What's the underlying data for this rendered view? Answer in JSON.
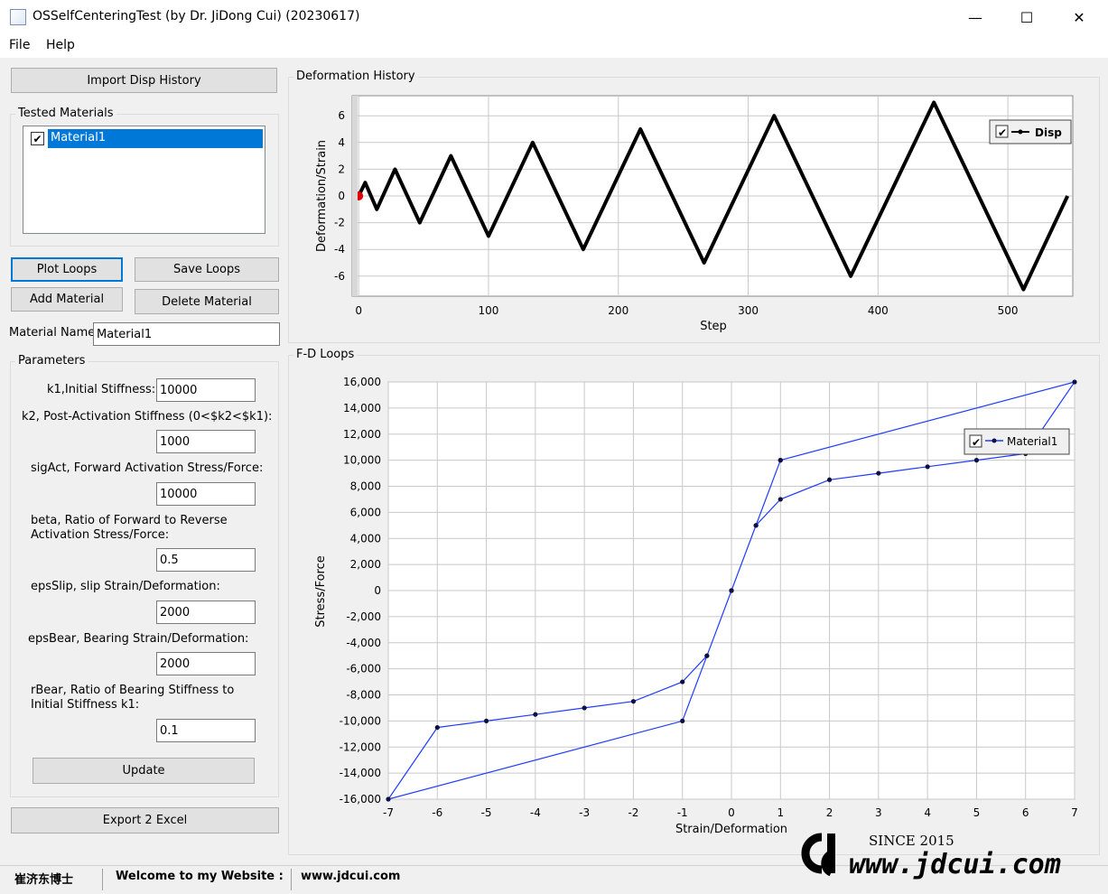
{
  "window": {
    "title": "OSSelfCenteringTest (by Dr. JiDong Cui) (20230617)",
    "minimize": "—",
    "maximize": "☐",
    "close": "✕"
  },
  "menu": {
    "file": "File",
    "help": "Help"
  },
  "left": {
    "import_button": "Import Disp History",
    "tested_materials_label": "Tested Materials",
    "materials": [
      {
        "name": "Material1",
        "checked": true
      }
    ],
    "plot_loops": "Plot Loops",
    "save_loops": "Save Loops",
    "add_material": "Add Material",
    "delete_material": "Delete Material",
    "material_name_label": "Material Name",
    "material_name_value": "Material1",
    "parameters_label": "Parameters",
    "params": {
      "k1_label": "k1,Initial Stiffness:",
      "k1_value": "10000",
      "k2_label": "k2, Post-Activation Stiffness (0<$k2<$k1):",
      "k2_value": "1000",
      "sigact_label": "sigAct, Forward Activation Stress/Force:",
      "sigact_value": "10000",
      "beta_label_1": "beta, Ratio of Forward to Reverse",
      "beta_label_2": "Activation Stress/Force:",
      "beta_value": "0.5",
      "epsslip_label": "epsSlip, slip Strain/Deformation:",
      "epsslip_value": "2000",
      "epsbear_label": "epsBear, Bearing Strain/Deformation:",
      "epsbear_value": "2000",
      "rbear_label_1": "rBear, Ratio of Bearing Stiffness to",
      "rbear_label_2": "Initial Stiffness k1:",
      "rbear_value": "0.1"
    },
    "update_button": "Update",
    "export_button": "Export 2 Excel"
  },
  "deformation_history": {
    "panel_label": "Deformation History",
    "chart_data": {
      "type": "line",
      "xlabel": "Step",
      "ylabel": "Deformation/Strain",
      "xlim": [
        -5,
        550
      ],
      "ylim": [
        -7.5,
        7.5
      ],
      "xticks": [
        0,
        100,
        200,
        300,
        400,
        500
      ],
      "yticks": [
        -6,
        -4,
        -2,
        0,
        2,
        4,
        6
      ],
      "grid": true,
      "legend_position": "top-right",
      "series": [
        {
          "name": "Disp",
          "color": "#000000",
          "x": [
            0,
            5,
            14,
            28,
            47,
            71,
            100,
            134,
            173,
            217,
            266,
            320,
            379,
            443,
            512,
            546
          ],
          "y": [
            0,
            1,
            -1,
            2,
            -2,
            3,
            -3,
            4,
            -4,
            5,
            -5,
            6,
            -6,
            7,
            -7,
            0
          ]
        }
      ],
      "marker": {
        "x": 0,
        "y": 0,
        "color": "#e00000"
      }
    }
  },
  "fd_loops": {
    "panel_label": "F-D Loops",
    "chart_data": {
      "type": "line",
      "xlabel": "Strain/Deformation",
      "ylabel": "Stress/Force",
      "xlim": [
        -7,
        7
      ],
      "ylim": [
        -16000,
        16000
      ],
      "xticks": [
        -7,
        -6,
        -5,
        -4,
        -3,
        -2,
        -1,
        0,
        1,
        2,
        3,
        4,
        5,
        6,
        7
      ],
      "yticks": [
        -16000,
        -14000,
        -12000,
        -10000,
        -8000,
        -6000,
        -4000,
        -2000,
        0,
        2000,
        4000,
        6000,
        8000,
        10000,
        12000,
        14000,
        16000
      ],
      "ytick_labels": [
        "-16,000",
        "-14,000",
        "-12,000",
        "-10,000",
        "-8,000",
        "-6,000",
        "-4,000",
        "-2,000",
        "0",
        "2,000",
        "4,000",
        "6,000",
        "8,000",
        "10,000",
        "12,000",
        "14,000",
        "16,000"
      ],
      "grid": true,
      "legend_position": "top-right",
      "series": [
        {
          "name": "Material1",
          "color": "#1f3cff",
          "marker_color": "#101040",
          "x": [
            0,
            1,
            7,
            6,
            5,
            4,
            3,
            2,
            1,
            0.5,
            0,
            -0.5,
            -1,
            -7,
            -6,
            -5,
            -4,
            -3,
            -2,
            -1,
            -0.5,
            0,
            0.5,
            1
          ],
          "y": [
            0,
            10000,
            16000,
            10500,
            10000,
            9500,
            9000,
            8500,
            7000,
            5000,
            0,
            -5000,
            -10000,
            -16000,
            -10500,
            -10000,
            -9500,
            -9000,
            -8500,
            -7000,
            -5000,
            0,
            5000,
            10000
          ]
        }
      ]
    }
  },
  "status": {
    "name": "崔济东博士",
    "welcome": "Welcome to my Website :",
    "website": "www.jdcui.com"
  },
  "watermark": {
    "since": "SINCE 2015",
    "url": "www.jdcui.com"
  }
}
